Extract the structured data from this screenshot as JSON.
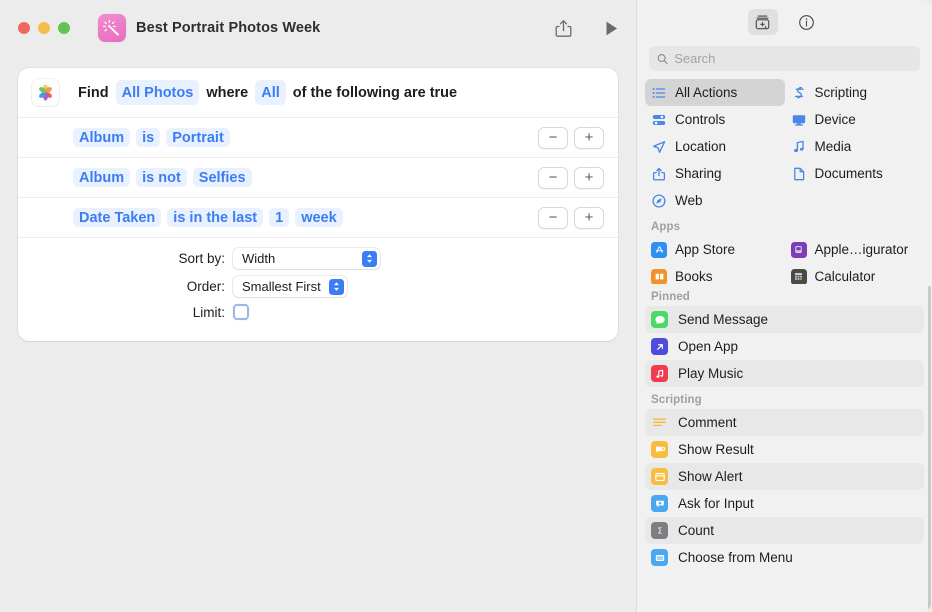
{
  "window": {
    "title": "Best Portrait Photos Week",
    "traffic_lights": [
      "close",
      "minimize",
      "zoom"
    ],
    "share_label": "Share",
    "run_label": "Run"
  },
  "find_card": {
    "app_icon": "photos-icon",
    "header": {
      "find_label": "Find",
      "source_token": "All Photos",
      "where_label": "where",
      "match_token": "All",
      "suffix_label": "of the following are true"
    },
    "filters": [
      {
        "field": "Album",
        "operator": "is",
        "value": "Portrait"
      },
      {
        "field": "Album",
        "operator": "is not",
        "value": "Selfies"
      },
      {
        "field": "Date Taken",
        "operator": "is in the last",
        "value": "1",
        "unit": "week"
      }
    ],
    "remove_label": "−",
    "add_label": "+",
    "sort_by": {
      "label": "Sort by:",
      "value": "Width"
    },
    "order": {
      "label": "Order:",
      "value": "Smallest First"
    },
    "limit": {
      "label": "Limit:",
      "checked": false
    }
  },
  "sidebar": {
    "toolbar": [
      {
        "name": "action-library-icon",
        "active": true
      },
      {
        "name": "info-icon",
        "active": false
      }
    ],
    "search": {
      "placeholder": "Search",
      "value": ""
    },
    "categories": [
      {
        "label": "All Actions",
        "icon": "list-icon",
        "selected": true
      },
      {
        "label": "Scripting",
        "icon": "scripting-icon",
        "selected": false
      },
      {
        "label": "Controls",
        "icon": "controls-icon",
        "selected": false
      },
      {
        "label": "Device",
        "icon": "device-icon",
        "selected": false
      },
      {
        "label": "Location",
        "icon": "location-icon",
        "selected": false
      },
      {
        "label": "Media",
        "icon": "media-icon",
        "selected": false
      },
      {
        "label": "Sharing",
        "icon": "sharing-icon",
        "selected": false
      },
      {
        "label": "Documents",
        "icon": "documents-icon",
        "selected": false
      },
      {
        "label": "Web",
        "icon": "web-icon",
        "selected": false
      }
    ],
    "apps_heading": "Apps",
    "apps": [
      {
        "label": "App Store",
        "color": "#2f8ef4"
      },
      {
        "label": "Apple…igurator",
        "color": "#7b3fb5"
      },
      {
        "label": "Books",
        "color": "#f3922b"
      },
      {
        "label": "Calculator",
        "color": "#4a4a4a"
      }
    ],
    "pinned_heading": "Pinned",
    "pinned": [
      {
        "label": "Send Message",
        "color": "#4cd964"
      },
      {
        "label": "Open App",
        "color": "#4e4ddb"
      },
      {
        "label": "Play Music",
        "color": "#f23b50"
      }
    ],
    "scripting_heading": "Scripting",
    "scripting": [
      {
        "label": "Comment",
        "color": "#f5b942",
        "style": "lines"
      },
      {
        "label": "Show Result",
        "color": "#f7bd3e",
        "style": "filled"
      },
      {
        "label": "Show Alert",
        "color": "#f7bd3e",
        "style": "filled"
      },
      {
        "label": "Ask for Input",
        "color": "#4aa8f0",
        "style": "filled"
      },
      {
        "label": "Count",
        "color": "#7d7d82",
        "style": "filled"
      },
      {
        "label": "Choose from Menu",
        "color": "#4aa8f0",
        "style": "filled"
      }
    ]
  },
  "colors": {
    "accent": "#3b7df4",
    "token_bg": "#eaf1fe",
    "sidebar_bg": "#f1f1f1",
    "selected_bg": "#d4d4d4"
  }
}
